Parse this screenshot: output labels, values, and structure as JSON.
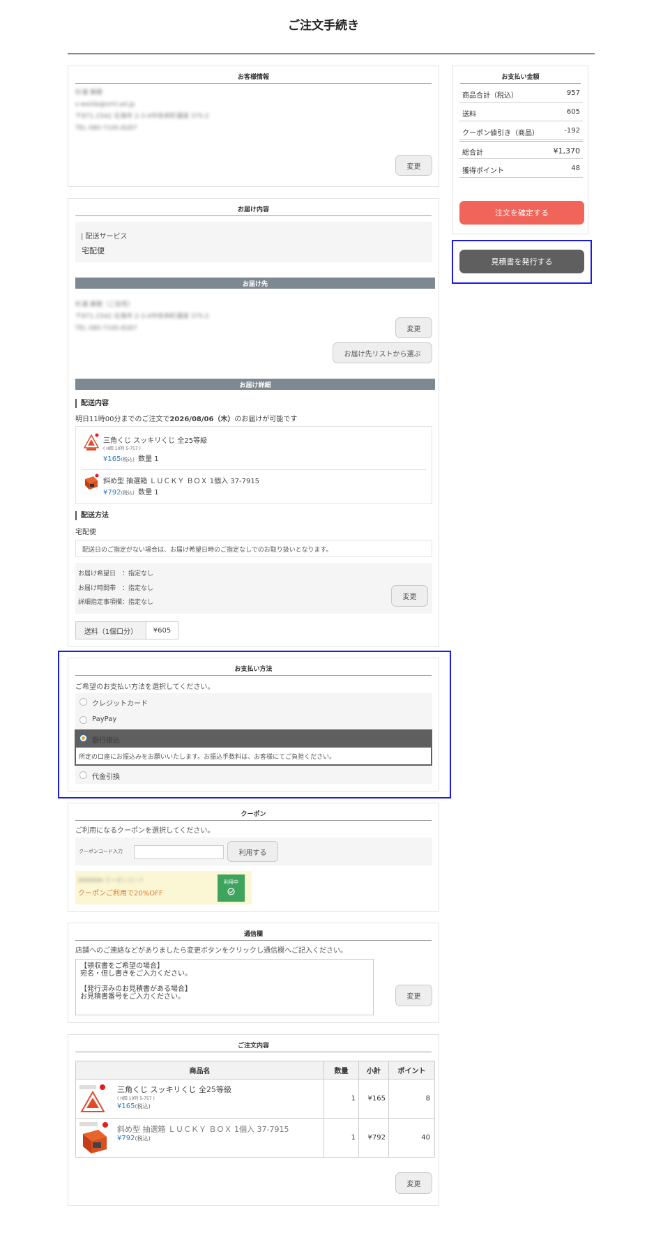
{
  "page": {
    "title": "ご注文手続き"
  },
  "customer": {
    "title": "お客様情報",
    "name": "杉浦 美樹",
    "email": "s-waida@xml.ad.jp",
    "address": "〒871-1542 北海市 2-3-4中央本町通道 375-2",
    "tel": "TEL 080-7100-8287",
    "change_label": "変更"
  },
  "delivery": {
    "title": "お届け内容",
    "service_label": "| 配送サービス",
    "service_value": "宅配便",
    "dest_bar": "お届け先",
    "dest_name": "杉浦 美樹（ご自宅）",
    "dest_address": "〒871-1542 北海市 2-3-4中央本町通道 375-2",
    "dest_tel": "TEL 080-7100-8287",
    "change_label": "変更",
    "list_button": "お届け先リストから選ぶ",
    "detail_bar": "お届け詳細",
    "contents_heading": "配送内容",
    "notice_pre": "明日11時00分までのご注文で",
    "notice_date": "2026/08/06（木）",
    "notice_post": "のお届けが可能です",
    "items": [
      {
        "name": "三角くじ スッキリくじ 全25等級",
        "sub": "( H回 10列 5-757 )",
        "price": "¥165",
        "tax": "(税込)",
        "qty": "数量 1"
      },
      {
        "name": "斜め型 抽選箱 ＬＵＣＫＹ ＢＯＸ 1個入 37-7915",
        "sub": "",
        "price": "¥792",
        "tax": "(税込)",
        "qty": "数量 1"
      }
    ],
    "method_heading": "配送方法",
    "method_value": "宅配便",
    "method_note": "配送日のご指定がない場合は、お届け希望日時のご指定なしでのお取り扱いとなります。",
    "wish_date": "お届け希望日　：指定なし",
    "wish_time": "お届け時間帯　：指定なし",
    "wish_detail": "詳細指定事項欄：指定なし",
    "method_change": "変更",
    "shipping_label": "送料（1個口分）",
    "shipping_value": "¥605"
  },
  "payment": {
    "title": "お支払い方法",
    "prompt": "ご希望のお支払い方法を選択してください。",
    "options": [
      "クレジットカード",
      "PayPay",
      "銀行振込",
      "代金引換"
    ],
    "selected_note": "所定の口座にお振込みをお願いいたします。お振込手数料は、お客様にてご負担ください。"
  },
  "coupon": {
    "title": "クーポン",
    "prompt": "ご利用になるクーポンを選択してください。",
    "code_label": "クーポンコード入力",
    "apply_label": "利用する",
    "coupon_name": "NNNNNN クーポンコード",
    "discount_text": "クーポンご利用で20%OFF",
    "in_use": "利用中"
  },
  "message": {
    "title": "通信欄",
    "prompt": "店舗へのご連絡などがありましたら変更ボタンをクリックし通信欄へご記入ください。",
    "line1": "【領収書をご希望の場合】",
    "line2": "宛名・但し書きをご入力ください。",
    "line3": "【発行済みのお見積書がある場合】",
    "line4": "お見積書番号をご入力ください。",
    "change_label": "変更"
  },
  "order": {
    "title": "ご注文内容",
    "headers": [
      "商品名",
      "数量",
      "小計",
      "ポイント"
    ],
    "rows": [
      {
        "name": "三角くじ スッキリくじ 全25等級",
        "sub": "( H回 10列 5-757 )",
        "price": "¥165",
        "tax": "(税込)",
        "qty": "1",
        "subtotal": "¥165",
        "points": "8"
      },
      {
        "name": "斜め型 抽選箱 ＬＵＣＫＹ ＢＯＸ 1個入 37-7915",
        "sub": "",
        "price": "¥792",
        "tax": "(税込)",
        "qty": "1",
        "subtotal": "¥792",
        "points": "40"
      }
    ],
    "change_label": "変更"
  },
  "summary": {
    "title": "お支払い金額",
    "rows": [
      {
        "label": "商品合計（税込）",
        "value": "957"
      },
      {
        "label": "送料",
        "value": "605"
      },
      {
        "label": "クーポン値引き（商品）",
        "value": "-192"
      },
      {
        "label": "総合計",
        "value": "¥1,370"
      },
      {
        "label": "獲得ポイント",
        "value": "48"
      }
    ],
    "confirm_label": "注文を確定する",
    "estimate_label": "見積書を発行する"
  },
  "colors": {
    "accent_red": "#f0645a",
    "dark_button": "#5f5f5f",
    "price_blue": "#2a7ac2",
    "coupon_orange": "#e8762c",
    "in_use_green": "#3da35d",
    "highlight_border": "#1a1ae6"
  }
}
